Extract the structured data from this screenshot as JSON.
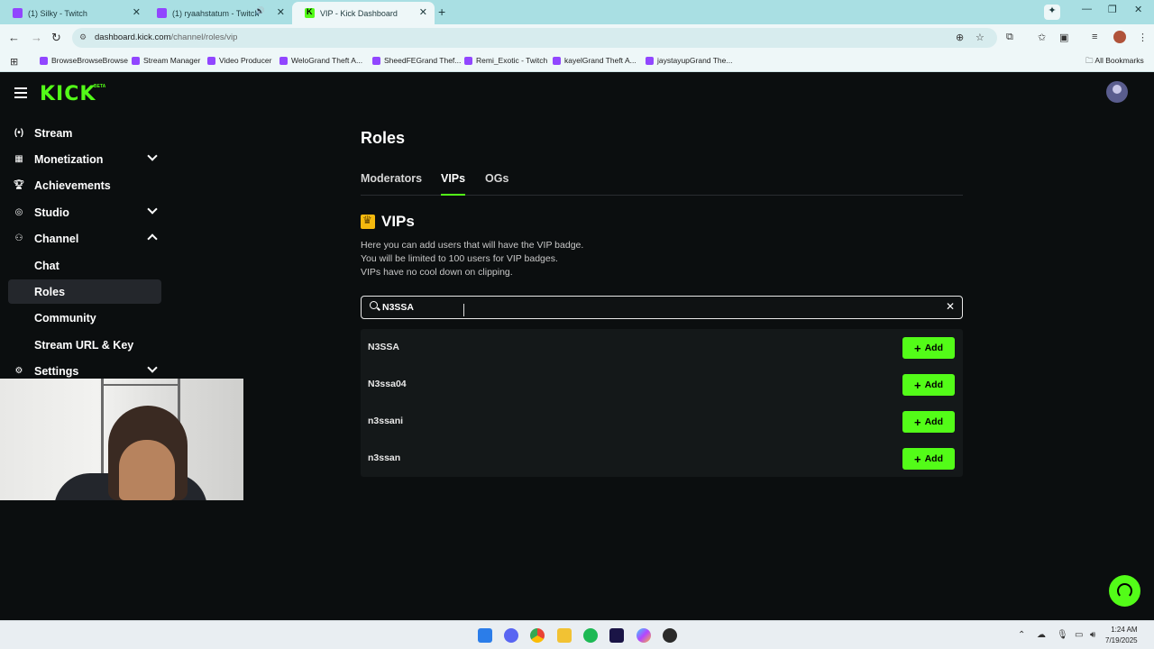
{
  "browser": {
    "tabs": [
      {
        "title": "(1) Silky - Twitch",
        "favicon": "twitch-icon"
      },
      {
        "title": "(1) ryaahstatum - Twitch",
        "favicon": "twitch-icon"
      },
      {
        "title": "VIP - Kick Dashboard",
        "favicon": "kick-icon"
      }
    ],
    "url_host": "dashboard.kick.com",
    "url_path": "/channel/roles/vip",
    "bookmarks": [
      "BrowseBrowseBrowse",
      "Stream Manager",
      "Video Producer",
      "WeloGrand Theft A...",
      "SheedFEGrand Thef...",
      "Remi_Exotic - Twitch",
      "kayelGrand Theft A...",
      "jaystayupGrand The..."
    ],
    "all_bookmarks": "All Bookmarks"
  },
  "app": {
    "logo": "KICK",
    "logo_badge": "BETA",
    "accent": "#53fc18"
  },
  "sidebar": {
    "items": [
      {
        "label": "Stream",
        "icon": "broadcast-icon"
      },
      {
        "label": "Monetization",
        "icon": "chart-icon"
      },
      {
        "label": "Achievements",
        "icon": "trophy-icon"
      },
      {
        "label": "Studio",
        "icon": "studio-icon"
      },
      {
        "label": "Channel",
        "icon": "users-icon"
      }
    ],
    "channel_sub": [
      "Chat",
      "Roles",
      "Community",
      "Stream URL & Key"
    ],
    "settings": {
      "label": "Settings",
      "icon": "gear-icon"
    }
  },
  "main": {
    "title": "Roles",
    "tabs": [
      "Moderators",
      "VIPs",
      "OGs"
    ],
    "section_title": "VIPs",
    "description": [
      "Here you can add users that will have the VIP badge.",
      "You will be limited to 100 users for VIP badges.",
      "VIPs have no cool down on clipping."
    ],
    "search": {
      "value": "N3SSA"
    },
    "results": [
      {
        "username": "N3SSA",
        "action": "Add"
      },
      {
        "username": "N3ssa04",
        "action": "Add"
      },
      {
        "username": "n3ssani",
        "action": "Add"
      },
      {
        "username": "n3ssan",
        "action": "Add"
      }
    ]
  },
  "taskbar": {
    "time": "1:24 AM",
    "date": "7/19/2025"
  }
}
